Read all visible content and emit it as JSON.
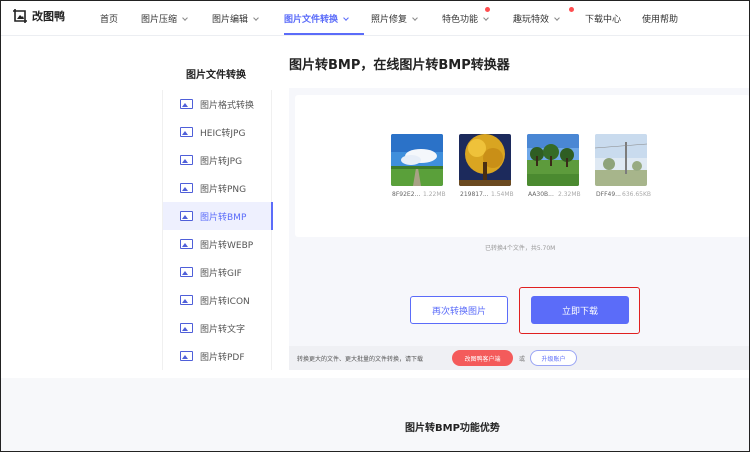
{
  "app": {
    "name": "改图鸭"
  },
  "nav": {
    "items": [
      {
        "label": "首页",
        "dropdown": false,
        "badge": false
      },
      {
        "label": "图片压缩",
        "dropdown": true,
        "badge": false
      },
      {
        "label": "图片编辑",
        "dropdown": true,
        "badge": false
      },
      {
        "label": "图片文件转换",
        "dropdown": true,
        "badge": false,
        "active": true
      },
      {
        "label": "照片修复",
        "dropdown": true,
        "badge": false
      },
      {
        "label": "特色功能",
        "dropdown": true,
        "badge": true
      },
      {
        "label": "趣玩特效",
        "dropdown": true,
        "badge": true
      },
      {
        "label": "下载中心",
        "dropdown": false,
        "badge": false
      },
      {
        "label": "使用帮助",
        "dropdown": false,
        "badge": false
      }
    ]
  },
  "sidebar": {
    "title": "图片文件转换",
    "items": [
      {
        "label": "图片格式转换"
      },
      {
        "label": "HEIC转JPG"
      },
      {
        "label": "图片转JPG"
      },
      {
        "label": "图片转PNG"
      },
      {
        "label": "图片转BMP",
        "active": true
      },
      {
        "label": "图片转WEBP"
      },
      {
        "label": "图片转GIF"
      },
      {
        "label": "图片转ICON"
      },
      {
        "label": "图片转文字"
      },
      {
        "label": "图片转PDF"
      }
    ]
  },
  "main": {
    "title": "图片转BMP，在线图片转BMP转换器",
    "files": [
      {
        "name": "8F92E2...",
        "size": "1.22MB"
      },
      {
        "name": "219817...",
        "size": "1.54MB"
      },
      {
        "name": "AA30B...",
        "size": "2.32MB"
      },
      {
        "name": "DFF49...",
        "size": "636.65KB"
      }
    ],
    "summary": "已转换4个文件，共5.70M",
    "convert_again_label": "再次转换图片",
    "download_label": "立即下载",
    "tip": "转换更大的文件、更大批量的文件转换，请下载",
    "client_label": "改图鸭客户端",
    "or": "或",
    "upgrade_label": "升级账户"
  },
  "features": {
    "title": "图片转BMP功能优势"
  },
  "colors": {
    "accent": "#5b6cf9",
    "highlight": "#e02020",
    "client_button": "#f45b5b"
  }
}
